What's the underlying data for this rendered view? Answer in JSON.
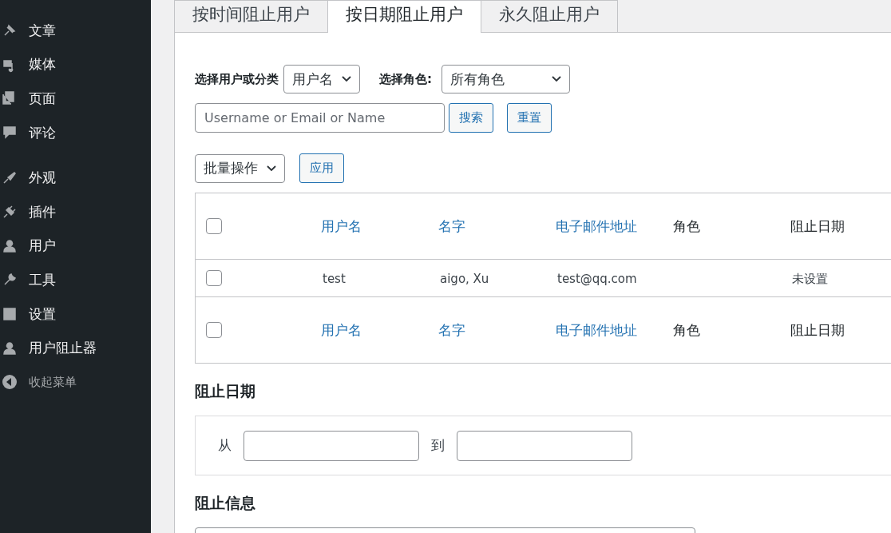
{
  "sidebar": {
    "groups": [
      {
        "items": [
          {
            "label": "文章"
          },
          {
            "label": "媒体"
          },
          {
            "label": "页面"
          },
          {
            "label": "评论"
          }
        ]
      },
      {
        "items": [
          {
            "label": "外观"
          },
          {
            "label": "插件"
          },
          {
            "label": "用户"
          },
          {
            "label": "工具"
          },
          {
            "label": "设置"
          },
          {
            "label": "用户阻止器"
          }
        ]
      }
    ],
    "collapse": "收起菜单"
  },
  "tabs": [
    {
      "label": "按时间阻止用户",
      "selected": false
    },
    {
      "label": "按日期阻止用户",
      "selected": true
    },
    {
      "label": "永久阻止用户",
      "selected": false
    }
  ],
  "filter": {
    "user_label": "选择用户或分类",
    "user_select": "用户名",
    "role_label": "选择角色:",
    "role_select": "所有角色",
    "search_placeholder": "Username or Email or Name",
    "search_button": "搜索",
    "reset_button": "重置"
  },
  "bulk": {
    "select": "批量操作",
    "apply": "应用"
  },
  "table": {
    "columns": [
      {
        "label": "用户名",
        "sortable": true
      },
      {
        "label": "名字",
        "sortable": true
      },
      {
        "label": "电子邮件地址",
        "sortable": true
      },
      {
        "label": "角色",
        "sortable": false
      },
      {
        "label": "阻止日期",
        "sortable": false
      }
    ],
    "footer_columns": [
      {
        "label": "用户名",
        "sortable": true
      },
      {
        "label": "名字",
        "sortable": true
      },
      {
        "label": "电子邮件地址",
        "sortable": true
      },
      {
        "label": "角色",
        "sortable": false
      },
      {
        "label": "阻止日期",
        "sortable": false
      }
    ],
    "header_checked": false,
    "footer_checked": false,
    "rows": [
      {
        "checked": false,
        "username": "test",
        "name": "aigo, Xu",
        "email": "test@qq.com",
        "date": "未设置"
      }
    ]
  },
  "date_section": {
    "title": "阻止日期",
    "from_label": "从",
    "to_label": "到"
  },
  "message_section": {
    "title": "阻止信息"
  }
}
